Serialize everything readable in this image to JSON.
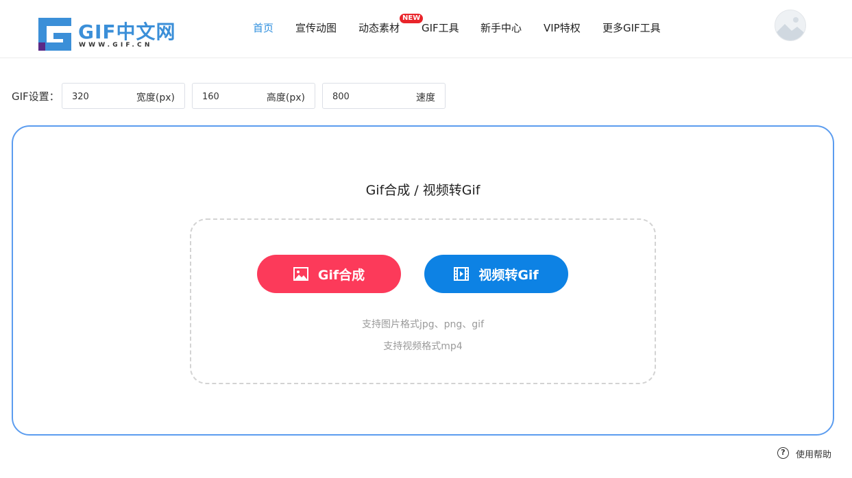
{
  "header": {
    "logo_text": "GIF中文网",
    "logo_sub": "WWW.GIF.CN",
    "nav": [
      {
        "label": "首页",
        "active": true
      },
      {
        "label": "宣传动图",
        "active": false
      },
      {
        "label": "动态素材",
        "active": false,
        "badge": "NEW"
      },
      {
        "label": "GIF工具",
        "active": false
      },
      {
        "label": "新手中心",
        "active": false
      },
      {
        "label": "VIP特权",
        "active": false
      },
      {
        "label": "更多GIF工具",
        "active": false
      }
    ]
  },
  "settings": {
    "label": "GIF设置：",
    "width": {
      "value": "320",
      "suffix": "宽度(px)"
    },
    "height": {
      "value": "160",
      "suffix": "高度(px)"
    },
    "speed": {
      "value": "800",
      "suffix": "速度"
    }
  },
  "upload": {
    "title": "Gif合成 / 视频转Gif",
    "gif_button": "Gif合成",
    "video_button": "视频转Gif",
    "note_images": "支持图片格式jpg、png、gif",
    "note_video": "支持视频格式mp4"
  },
  "help": {
    "label": "使用帮助"
  },
  "colors": {
    "brand_blue": "#3b8fd8",
    "nav_active": "#2f8fde",
    "gif_button": "#fc3a5a",
    "video_button": "#0d82e4",
    "upload_border": "#5b9cef",
    "badge_red": "#e9242a"
  }
}
